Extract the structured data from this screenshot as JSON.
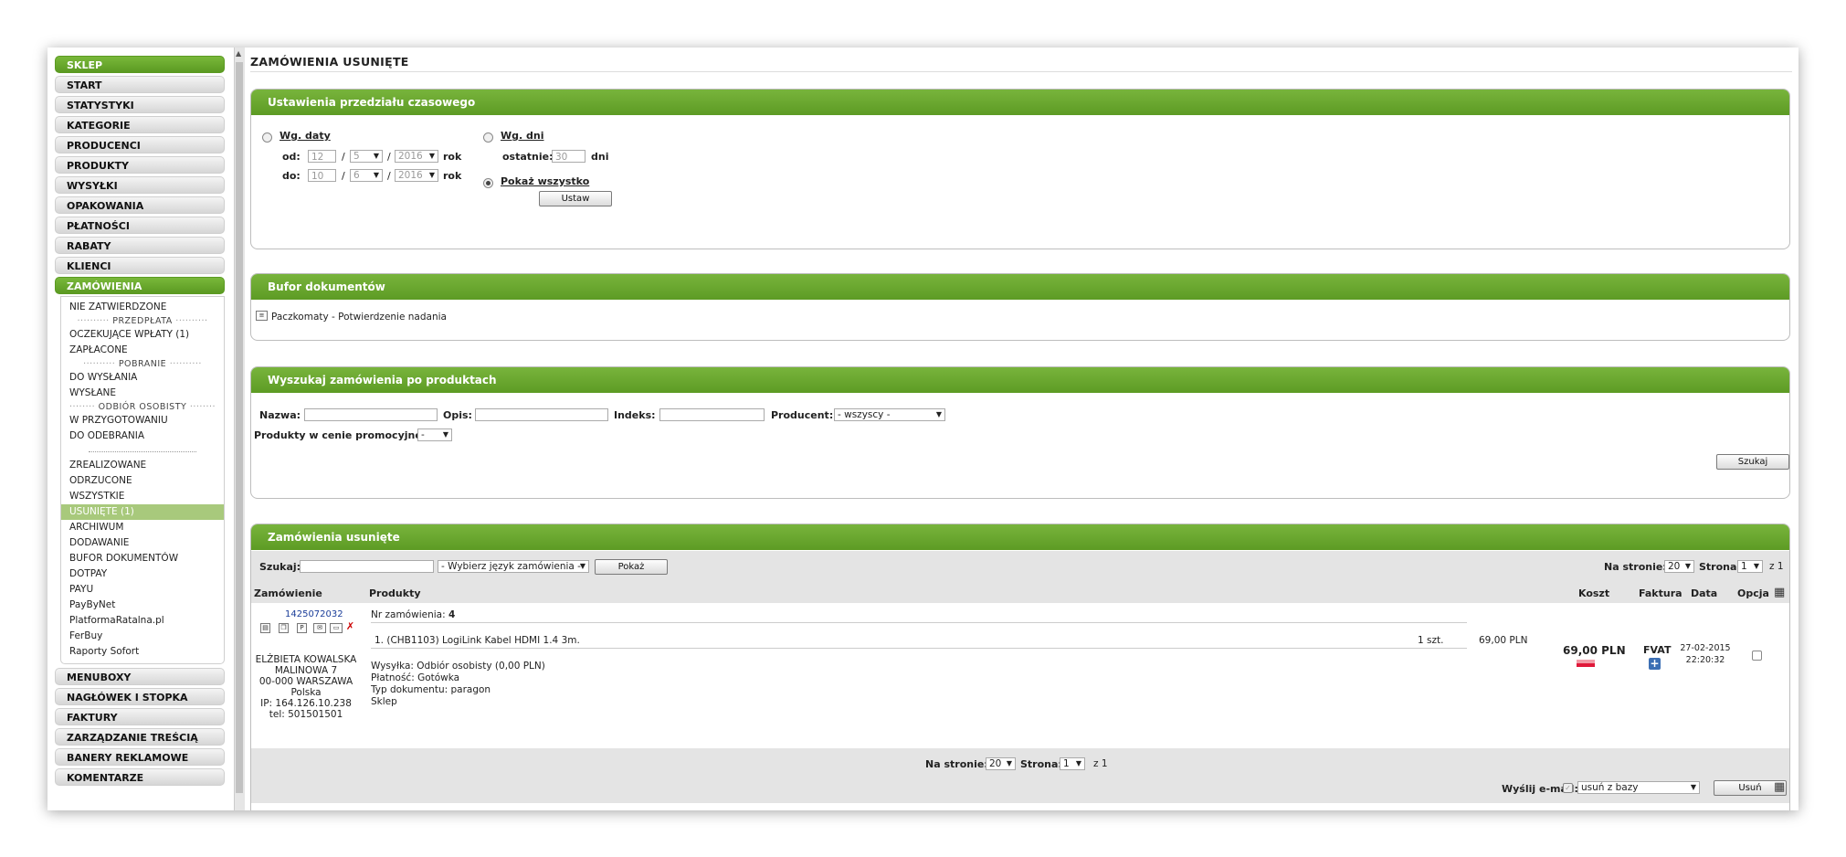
{
  "sidebar": {
    "top_items": [
      "SKLEP",
      "START",
      "STATYSTYKI",
      "KATEGORIE",
      "PRODUCENCI",
      "PRODUKTY",
      "WYSYŁKI",
      "OPAKOWANIA",
      "PŁATNOŚCI",
      "RABATY",
      "KLIENCI",
      "ZAMÓWIENIA"
    ],
    "orders_sub": {
      "nie_zatwierdzone": "NIE ZATWIERDZONE",
      "sep_przedplata": "PRZEDPŁATA",
      "oczekujace": "OCZEKUJĄCE WPŁATY (1)",
      "zaplacone": "ZAPŁACONE",
      "sep_pobranie": "POBRANIE",
      "do_wyslania": "DO WYSŁANIA",
      "wyslane": "WYSŁANE",
      "sep_odbior": "ODBIÓR OSOBISTY",
      "w_przygotowaniu": "W PRZYGOTOWANIU",
      "do_odebrania": "DO ODEBRANIA",
      "zrealizowane": "ZREALIZOWANE",
      "odrzucone": "ODRZUCONE",
      "wszystkie": "WSZYSTKIE",
      "usuniete": "USUNIĘTE (1)",
      "archiwum": "ARCHIWUM",
      "dodawanie": "DODAWANIE",
      "bufor": "BUFOR DOKUMENTÓW",
      "dotpay": "DOTPAY",
      "payu": "PAYU",
      "paybynet": "PayByNet",
      "platforma": "PlatformaRatalna.pl",
      "ferbuy": "FerBuy",
      "sofort": "Raporty Sofort"
    },
    "bottom_items": [
      "MENUBOXY",
      "NAGŁÓWEK I STOPKA",
      "FAKTURY",
      "ZARZĄDZANIE TREŚCIĄ",
      "BANERY REKLAMOWE",
      "KOMENTARZE"
    ]
  },
  "page_title": "ZAMÓWIENIA USUNIĘTE",
  "time_panel": {
    "header": "Ustawienia przedziału czasowego",
    "by_date_label": "Wg. daty",
    "from_label": "od:",
    "to_label": "do:",
    "from_day": "12",
    "from_month": "5",
    "from_year": "2016",
    "to_day": "10",
    "to_month": "6",
    "to_year": "2016",
    "slash": "/",
    "year_word": "rok",
    "by_days_label": "Wg. dni",
    "last_label": "ostatnie:",
    "last_value": "30",
    "days_word": "dni",
    "show_all_label": "Pokaż wszystko",
    "set_button": "Ustaw"
  },
  "buffer_panel": {
    "header": "Bufor dokumentów",
    "item": "Paczkomaty - Potwierdzenie nadania"
  },
  "search_panel": {
    "header": "Wyszukaj zamówienia po produktach",
    "name_label": "Nazwa:",
    "desc_label": "Opis:",
    "index_label": "Indeks:",
    "producer_label": "Producent:",
    "producer_value": "- wszyscy -",
    "promo_label": "Produkty w cenie promocyjnej:",
    "promo_value": "-",
    "search_button": "Szukaj"
  },
  "orders_panel": {
    "header": "Zamówienia usunięte",
    "search_label": "Szukaj:",
    "lang_select": "- Wybierz język zamówienia -",
    "show_button": "Pokaż",
    "per_page_label": "Na stronie:",
    "per_page_value": "20",
    "page_label": "Strona:",
    "page_value": "1",
    "of_pages": "z 1",
    "columns": {
      "order": "Zamówienie",
      "products": "Produkty",
      "cost": "Koszt",
      "invoice": "Faktura",
      "date": "Data",
      "option": "Opcja"
    },
    "order": {
      "id": "1425072032",
      "number_label": "Nr zamówienia:",
      "number": "4",
      "product_line": "1. (CHB1103) LogiLink Kabel HDMI 1.4 3m.",
      "qty": "1 szt.",
      "line_price": "69,00 PLN",
      "shipping": "Wysyłka: Odbiór osobisty (0,00 PLN)",
      "payment": "Płatność: Gotówka",
      "doc_type": "Typ dokumentu: paragon",
      "shop": "Sklep",
      "customer_name": "ELŻBIETA KOWALSKA",
      "customer_street": "MALINOWA 7",
      "customer_city": "00-000 WARSZAWA",
      "customer_country": "Polska",
      "customer_ip": "IP: 164.126.10.238",
      "customer_tel": "tel: 501501501",
      "cost": "69,00 PLN",
      "invoice": "FVAT",
      "date": "27-02-2015",
      "time": "22:20:32"
    },
    "bottom": {
      "send_email_label": "Wyślij e-mail:",
      "action_value": "usuń z bazy",
      "delete_button": "Usuń"
    }
  }
}
